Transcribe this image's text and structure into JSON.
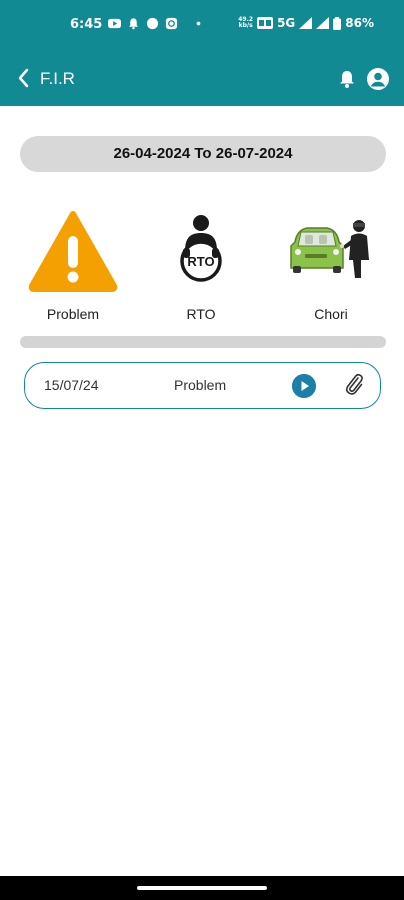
{
  "status": {
    "time": "6:45",
    "network": "5G",
    "battery": "86%",
    "speed_top": "49.2",
    "speed_bottom": "kb/s"
  },
  "header": {
    "title": "F.I.R"
  },
  "filter": {
    "date_range": "26-04-2024 To 26-07-2024"
  },
  "categories": [
    {
      "label": "Problem",
      "icon": "warning-icon"
    },
    {
      "label": "RTO",
      "icon": "rto-icon"
    },
    {
      "label": "Chori",
      "icon": "car-theft-icon"
    }
  ],
  "records": [
    {
      "date": "15/07/24",
      "type": "Problem"
    }
  ],
  "colors": {
    "primary": "#128a93",
    "warning": "#f4a000",
    "play": "#1c7fa8",
    "car": "#8bc34a"
  }
}
